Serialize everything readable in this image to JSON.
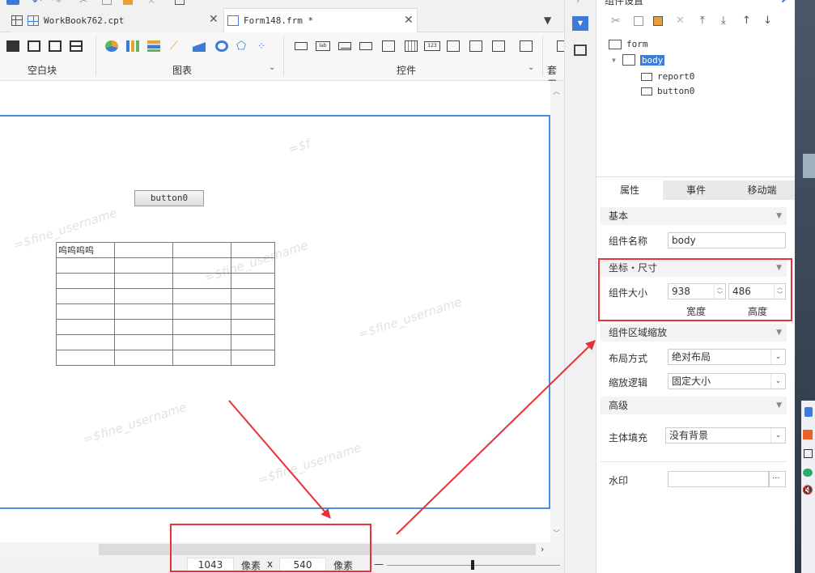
{
  "tabs": [
    {
      "label": "WorkBook762.cpt",
      "active": false
    },
    {
      "label": "Form148.frm *",
      "active": true
    }
  ],
  "ribbon": {
    "groups": [
      {
        "label": "空白块"
      },
      {
        "label": "图表"
      },
      {
        "label": "控件"
      },
      {
        "label": "套用"
      }
    ]
  },
  "canvas": {
    "button_label": "button0",
    "report_first_cell": "呜呜呜呜",
    "watermark_text": "=$fine_username",
    "watermark_short": "=$f"
  },
  "statusbar": {
    "width_value": "1043",
    "width_unit": "像素",
    "separator": "x",
    "height_value": "540",
    "height_unit": "像素",
    "zoom_minus": "—"
  },
  "right_panel": {
    "title": "组件设置",
    "tree": [
      {
        "label": "form",
        "level": 0
      },
      {
        "label": "body",
        "level": 1,
        "selected": true
      },
      {
        "label": "report0",
        "level": 2
      },
      {
        "label": "button0",
        "level": 2
      }
    ],
    "tabs": [
      {
        "label": "属性",
        "active": true
      },
      {
        "label": "事件",
        "active": false
      },
      {
        "label": "移动端",
        "active": false
      }
    ],
    "sections": {
      "basic": "基本",
      "coords": "坐标・尺寸",
      "zoom": "组件区域缩放",
      "advanced": "高级"
    },
    "fields": {
      "name_label": "组件名称",
      "name_value": "body",
      "size_label": "组件大小",
      "width_value": "938",
      "height_value": "486",
      "width_caption": "宽度",
      "height_caption": "高度",
      "layout_label": "布局方式",
      "layout_value": "绝对布局",
      "scale_label": "缩放逻辑",
      "scale_value": "固定大小",
      "fill_label": "主体填充",
      "fill_value": "没有背景",
      "watermark_label": "水印",
      "watermark_btn": "···"
    }
  },
  "colors": {
    "accent": "#4a90e2",
    "annotation": "#e8323a",
    "selection": "#3d7bd9"
  }
}
